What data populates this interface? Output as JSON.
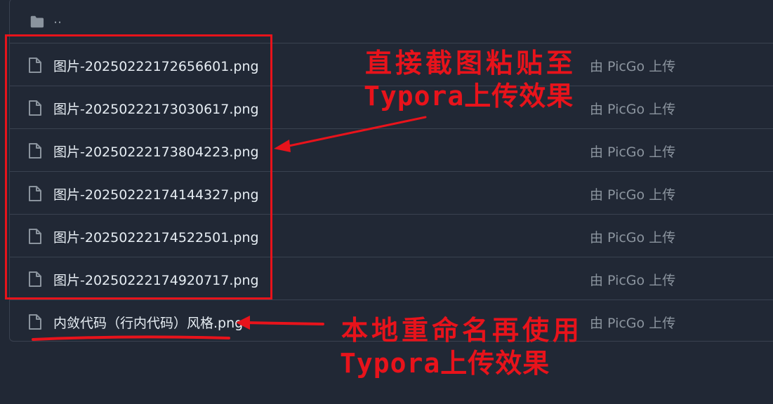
{
  "parent_dir": {
    "label": "..",
    "icon": "folder-icon"
  },
  "files": [
    {
      "name": "图片-20250222172656601.png",
      "commit": "由 PicGo 上传",
      "icon": "file-icon"
    },
    {
      "name": "图片-20250222173030617.png",
      "commit": "由 PicGo 上传",
      "icon": "file-icon"
    },
    {
      "name": "图片-20250222173804223.png",
      "commit": "由 PicGo 上传",
      "icon": "file-icon"
    },
    {
      "name": "图片-20250222174144327.png",
      "commit": "由 PicGo 上传",
      "icon": "file-icon"
    },
    {
      "name": "图片-20250222174522501.png",
      "commit": "由 PicGo 上传",
      "icon": "file-icon"
    },
    {
      "name": "图片-20250222174920717.png",
      "commit": "由 PicGo 上传",
      "icon": "file-icon"
    },
    {
      "name": "内敛代码（行内代码）风格.png",
      "commit": "由 PicGo 上传",
      "icon": "file-icon"
    }
  ],
  "annotations": {
    "top_line1": "直接截图粘贴至",
    "top_line2": "Typora上传效果",
    "bottom_line1": "本地重命名再使用",
    "bottom_line2": "Typora上传效果"
  },
  "colors": {
    "background": "#212835",
    "border": "#3a4250",
    "text_primary": "#e6edf3",
    "text_muted": "#8b949e",
    "annotation_red": "#e8131b"
  }
}
